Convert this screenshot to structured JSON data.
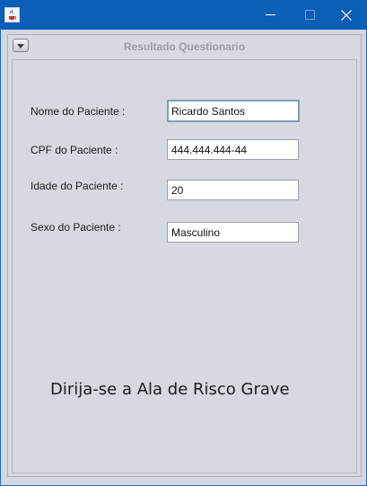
{
  "window": {
    "icon": "java-cup-icon",
    "controls": {
      "minimize": "minimize-icon",
      "maximize": "maximize-icon",
      "close": "close-icon"
    }
  },
  "internal_frame": {
    "title": "Resultado Questionario",
    "menu_icon": "chevron-down-icon"
  },
  "form": {
    "nome_label": "Nome do Paciente :",
    "nome_value": "Ricardo Santos",
    "cpf_label": "CPF do Paciente :",
    "cpf_value": "444.444.444-44",
    "idade_label": "Idade do Paciente :",
    "idade_value": "20",
    "sexo_label": "Sexo do Paciente :",
    "sexo_value": "Masculino"
  },
  "result": {
    "message": "Dirija-se a Ala de Risco Grave"
  }
}
